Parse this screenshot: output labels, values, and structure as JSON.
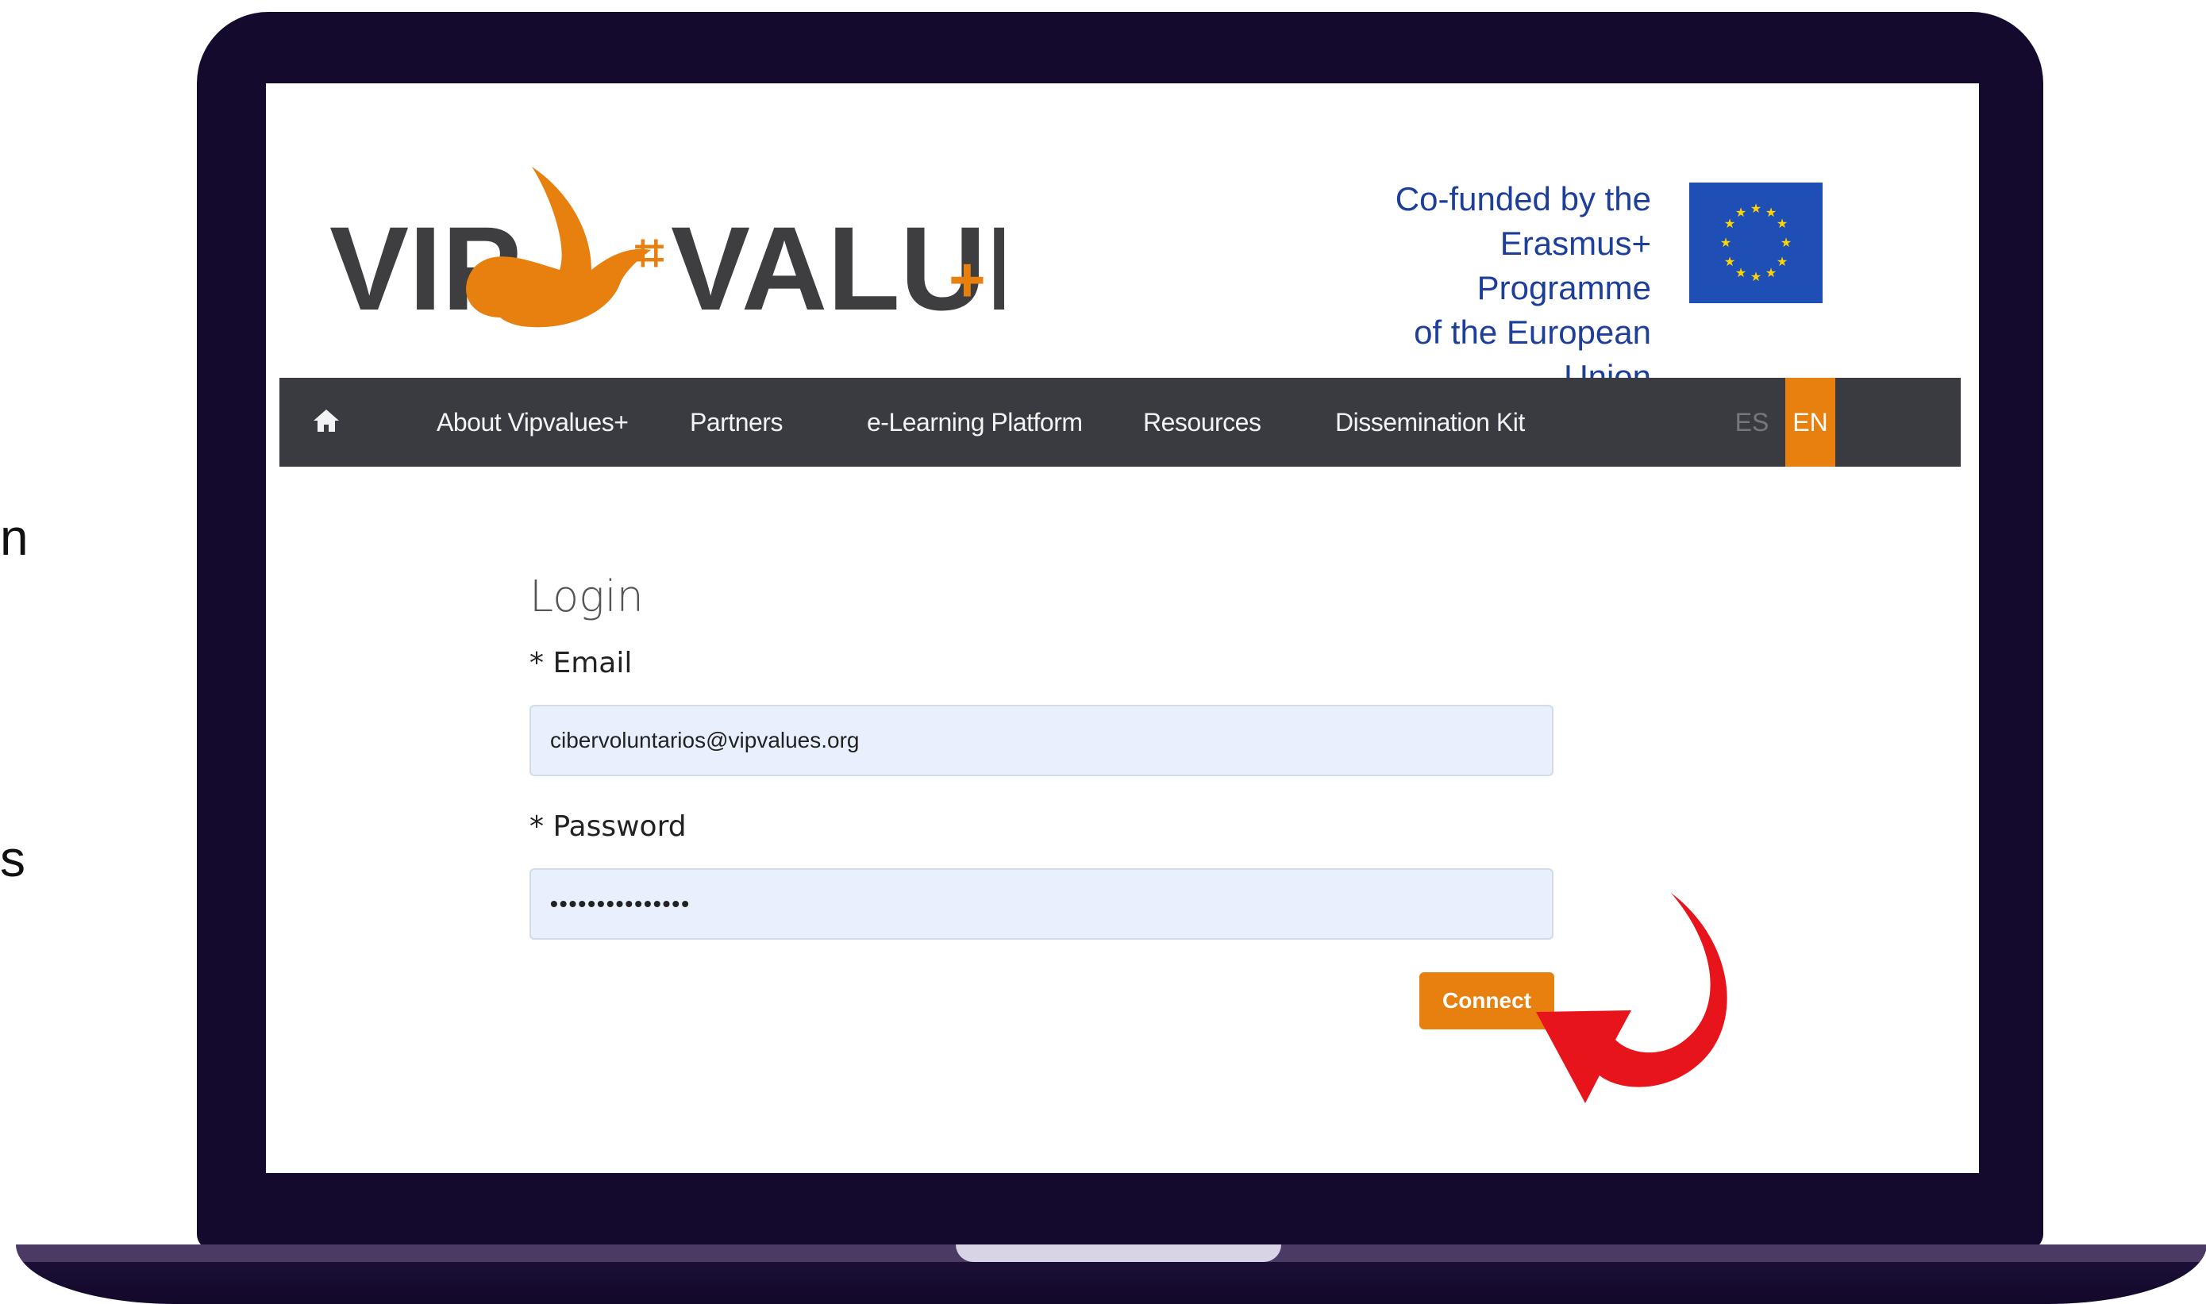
{
  "outside_text": {
    "line1": "n",
    "line2": "s"
  },
  "header": {
    "logo_text_left": "VIP",
    "logo_text_right": "VALUES",
    "logo_plus": "+",
    "eu_lines": [
      "Co-funded by the",
      "Erasmus+ Programme",
      "of the European Union"
    ]
  },
  "nav": {
    "home_icon": "home-icon",
    "items": [
      "About Vipvalues+",
      "Partners",
      "e-Learning Platform",
      "Resources",
      "Dissemination Kit"
    ],
    "lang_es": "ES",
    "lang_en": "EN"
  },
  "login": {
    "title": "Login",
    "email_label": "* Email",
    "email_value": "cibervoluntarios@vipvalues.org",
    "password_label": "* Password",
    "password_value": "•••••••••••••••",
    "button": "Connect"
  },
  "colors": {
    "accent": "#e8800f",
    "navbar": "#393b40",
    "eu_blue": "#1d3f9a",
    "laptop_frame": "#130a2e",
    "arrow": "#e8141b"
  }
}
